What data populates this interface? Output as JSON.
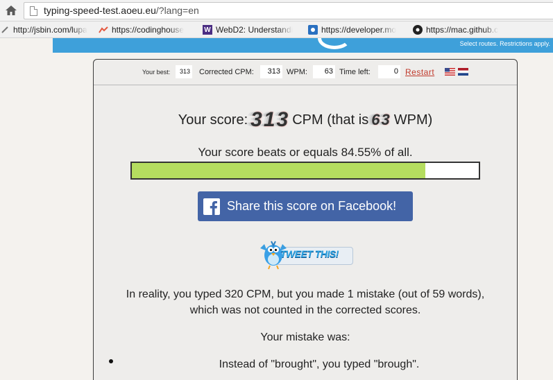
{
  "browser": {
    "url_host": "typing-speed-test.aoeu.eu",
    "url_path": "/?lang=en",
    "bookmarks": [
      {
        "label": "http://jsbin.com/lupa",
        "icon": "jsbin-icon"
      },
      {
        "label": "https://codinghouse",
        "icon": "codinghouse-icon"
      },
      {
        "label": "WebD2: Understandi",
        "icon": "uw-icon"
      },
      {
        "label": "https://developer.mo",
        "icon": "developer-icon"
      },
      {
        "label": "https://mac.github.c",
        "icon": "github-icon"
      }
    ]
  },
  "banner": {
    "text": "Select routes. Restrictions apply.",
    "color": "#3ea0da"
  },
  "stats": {
    "best_label": "Your best:",
    "best_value": "313",
    "cpm_label": "Corrected CPM:",
    "cpm_value": "313",
    "wpm_label": "WPM:",
    "wpm_value": "63",
    "time_label": "Time left:",
    "time_value": "0",
    "restart_label": "Restart",
    "languages": [
      "us-flag-icon",
      "nl-flag-icon"
    ]
  },
  "score": {
    "prefix": "Your score:",
    "cpm": "313",
    "middle": "CPM (that is",
    "wpm": "63",
    "suffix": "WPM)"
  },
  "beats": {
    "text": "Your score beats or equals 84.55% of all.",
    "percent": 84.55,
    "fill_color": "#b5dd5f"
  },
  "share": {
    "facebook_label": "Share this score on Facebook!",
    "facebook_color": "#4364a6",
    "tweet_label": "TWEET THIS!"
  },
  "summary": {
    "line1": "In reality, you typed 320 CPM, but you made 1 mistake (out of 59 words),",
    "line2": "which was not counted in the corrected scores."
  },
  "mistakes": {
    "title": "Your mistake was:",
    "items": [
      "Instead of \"brought\", you typed \"brough\"."
    ]
  }
}
